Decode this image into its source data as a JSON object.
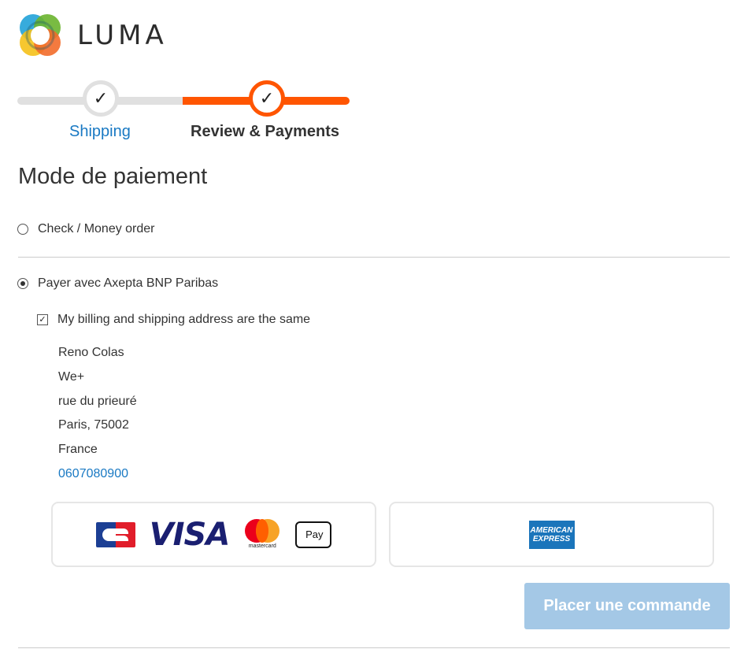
{
  "brand": {
    "name": "LUMA"
  },
  "progress": {
    "steps": [
      {
        "label": "Shipping",
        "state": "complete"
      },
      {
        "label": "Review & Payments",
        "state": "active"
      }
    ]
  },
  "payment": {
    "title": "Mode de paiement",
    "methods": [
      {
        "label": "Check / Money order",
        "selected": false
      },
      {
        "label": "Payer avec Axepta BNP Paribas",
        "selected": true
      }
    ],
    "billing_same_label": "My billing and shipping address are the same",
    "billing_same_checked": true,
    "address": {
      "name": "Reno Colas",
      "company": "We+",
      "street": "rue du prieuré",
      "city_line": "Paris, 75002",
      "country": "France",
      "phone": "0607080900"
    },
    "card_options": [
      {
        "icons": [
          "cb-logo",
          "visa-logo",
          "mastercard-logo",
          "apple-pay-logo"
        ]
      },
      {
        "icons": [
          "american-express-logo"
        ]
      }
    ],
    "brand_marks": {
      "visa": "VISA",
      "mastercard": "mastercard",
      "apple_pay": "Pay",
      "amex_line1": "AMERICAN",
      "amex_line2": "EXPRESS"
    },
    "place_order_label": "Placer une commande"
  },
  "colors": {
    "accent": "#ff5501",
    "link": "#1979c3",
    "button_disabled": "#a4c8e6",
    "track": "#e0e0e0"
  }
}
